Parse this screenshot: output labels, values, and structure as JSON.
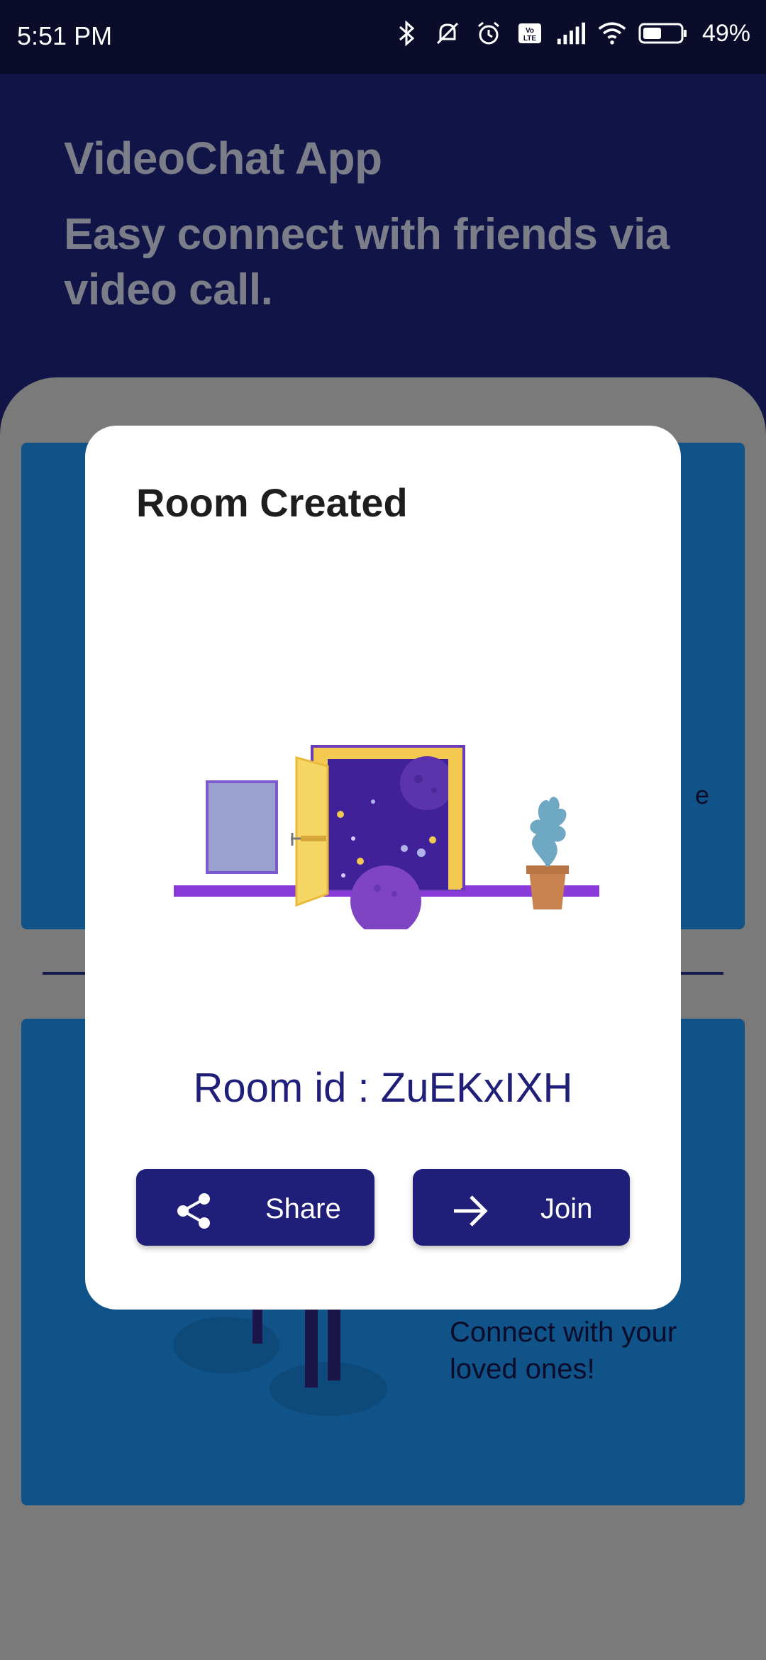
{
  "status_bar": {
    "time": "5:51 PM",
    "battery_percent": "49%",
    "icons": [
      "bluetooth-icon",
      "mute-icon",
      "alarm-icon",
      "volte-icon",
      "signal-icon",
      "wifi-icon",
      "battery-icon"
    ]
  },
  "header": {
    "title": "VideoChat App",
    "subtitle": "Easy connect with friends via video call."
  },
  "background_cards": {
    "top_card_fragment": "e",
    "bottom_card_text": "Connect with your loved ones!"
  },
  "dialog": {
    "title": "Room Created",
    "room_id_text": "Room id : ZuEKxIXH",
    "share_button": {
      "label": "Share",
      "icon": "share-icon"
    },
    "join_button": {
      "label": "Join",
      "icon": "arrow-right-icon"
    }
  },
  "colors": {
    "primary": "#1f1f7a",
    "header_bg": "#101447",
    "card_bg": "#0f5389",
    "dialog_bg": "#ffffff"
  }
}
